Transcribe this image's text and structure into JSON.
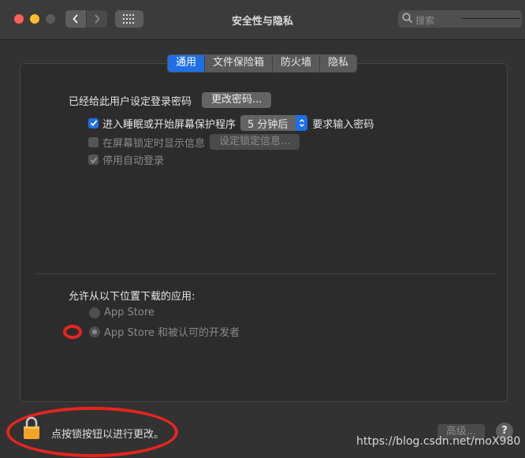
{
  "window": {
    "title": "安全性与隐私"
  },
  "search": {
    "placeholder": "搜索"
  },
  "tabs": [
    "通用",
    "文件保险箱",
    "防火墙",
    "隐私"
  ],
  "general": {
    "password_set_text": "已经给此用户设定登录密码",
    "change_password_button": "更改密码...",
    "require_password_checkbox": {
      "checked": true,
      "label_before": "进入睡眠或开始屏幕保护程序",
      "delay_value": "5 分钟后",
      "label_after": "要求输入密码"
    },
    "show_message_checkbox": {
      "checked": false,
      "enabled": false,
      "label": "在屏幕锁定时显示信息"
    },
    "set_lock_message_button": "设定锁定信息...",
    "disable_auto_login_checkbox": {
      "checked": true,
      "enabled": false,
      "label": "停用自动登录"
    }
  },
  "downloads": {
    "heading": "允许从以下位置下载的应用:",
    "options": [
      {
        "label": "App Store",
        "selected": false
      },
      {
        "label": "App Store 和被认可的开发者",
        "selected": true
      }
    ]
  },
  "footer": {
    "lock_text": "点按锁按钮以进行更改。",
    "advanced_button": "高级...",
    "help_button": "?"
  },
  "watermark": "https://blog.csdn.net/moX980",
  "colors": {
    "accent": "#1f6fe6",
    "annotation": "#e8241f",
    "lock": "#f0a52a"
  }
}
